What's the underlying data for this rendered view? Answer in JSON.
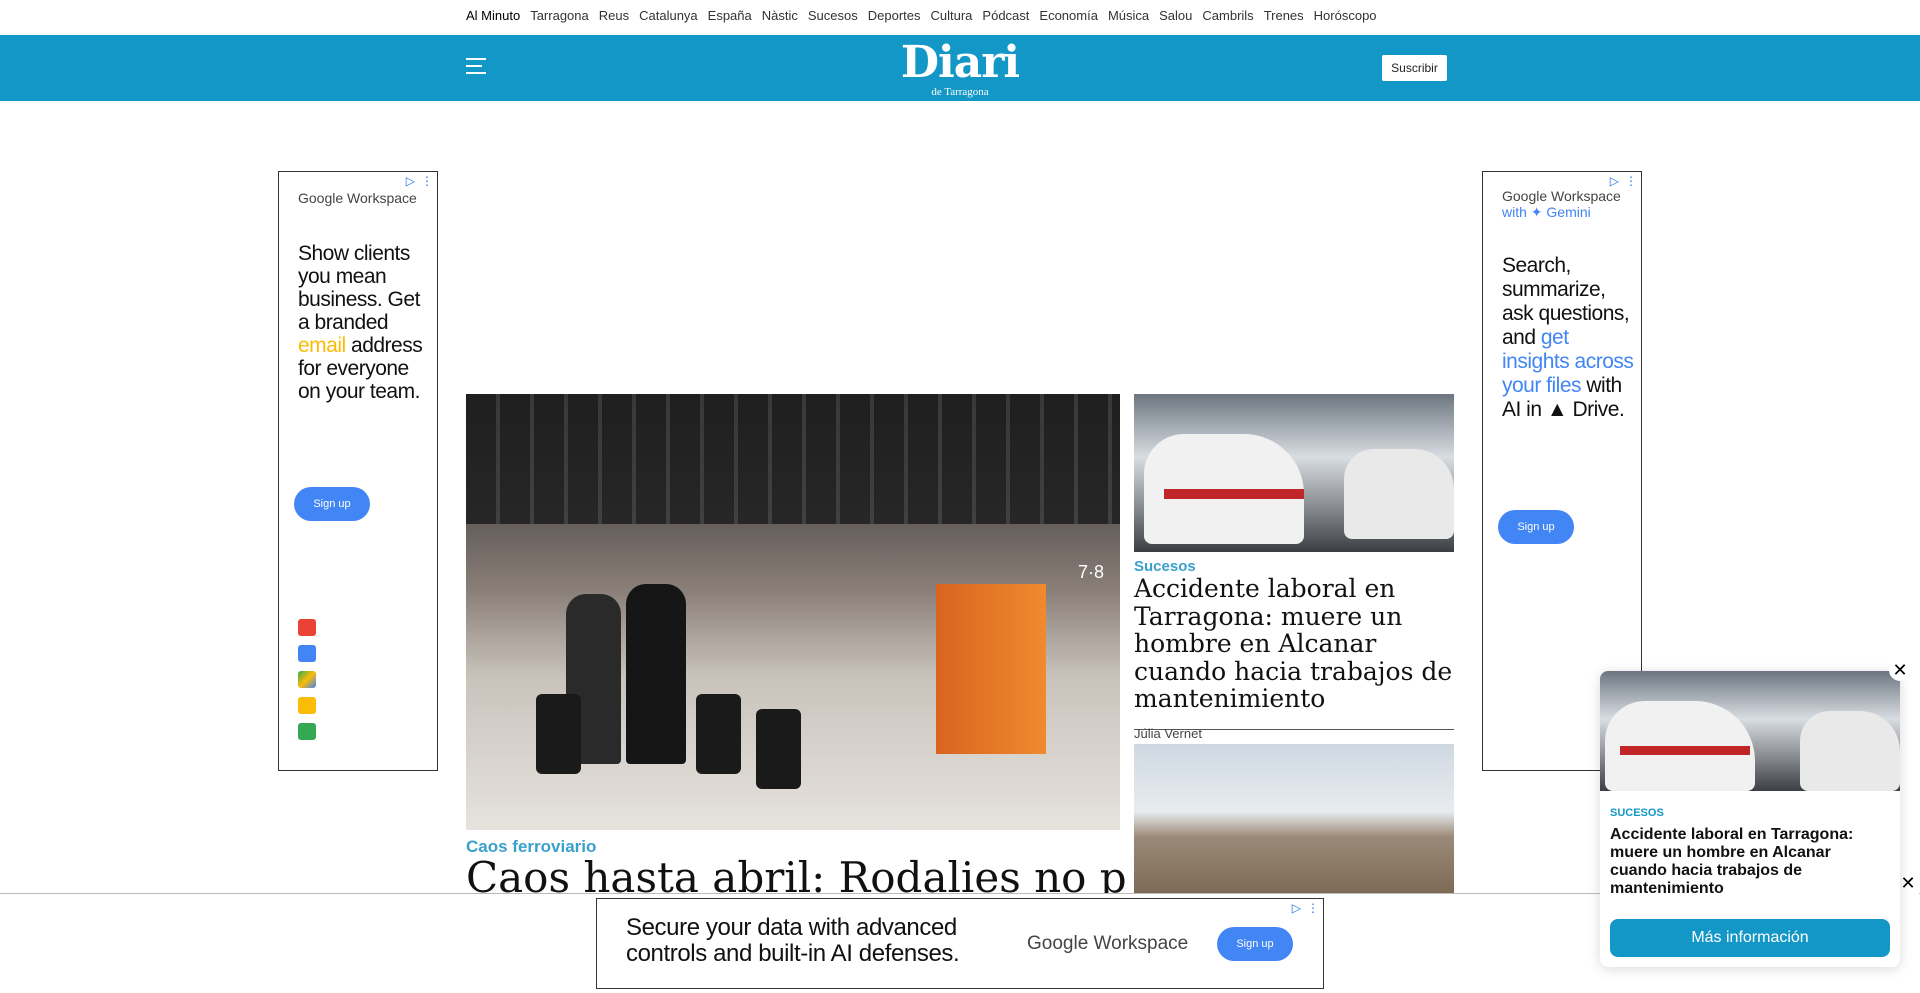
{
  "topnav": {
    "items": [
      "Al Minuto",
      "Tarragona",
      "Reus",
      "Catalunya",
      "España",
      "Nàstic",
      "Sucesos",
      "Deportes",
      "Cultura",
      "Pódcast",
      "Economía",
      "Música",
      "Salou",
      "Cambrils",
      "Trenes",
      "Horóscopo"
    ]
  },
  "header": {
    "logo_main": "Diari",
    "logo_sub": "de Tarragona",
    "subscribe_label": "Suscribir"
  },
  "ad_left": {
    "brand": "Google Workspace",
    "line_pre": "Show clients you mean business. Get a branded ",
    "line_hi": "email",
    "line_post": " address for everyone on your team.",
    "signup": "Sign up"
  },
  "ad_right": {
    "brand_line1": "Google Workspace",
    "brand_line2": "with ✦ Gemini",
    "line_pre": "Search, summarize, ask questions, and ",
    "line_hi": "get insights across your files",
    "line_post": " with AI in ▲ Drive.",
    "signup": "Sign up"
  },
  "hero": {
    "kicker": "Caos ferroviario",
    "title": "Caos hasta abril: Rodalies no prevé",
    "image_number": "7·8"
  },
  "side_article": {
    "kicker": "Sucesos",
    "title": "Accidente laboral en Tarragona: muere un hombre en Alcanar cuando hacia trabajos de mantenimiento",
    "author": "Júlia Vernet"
  },
  "banner_ad": {
    "text_line1": "Secure your data with advanced",
    "text_line2": "controls and built-in AI defenses.",
    "brand": "Google Workspace",
    "signup": "Sign up"
  },
  "popup": {
    "kicker": "SUCESOS",
    "title": "Accidente laboral en Tarragona: muere un hombre en Alcanar cuando hacia trabajos de mantenimiento",
    "button": "Más información"
  },
  "colors": {
    "header_bg": "#1397c6",
    "kicker": "#3ba0cc",
    "google_blue": "#4285f4"
  }
}
